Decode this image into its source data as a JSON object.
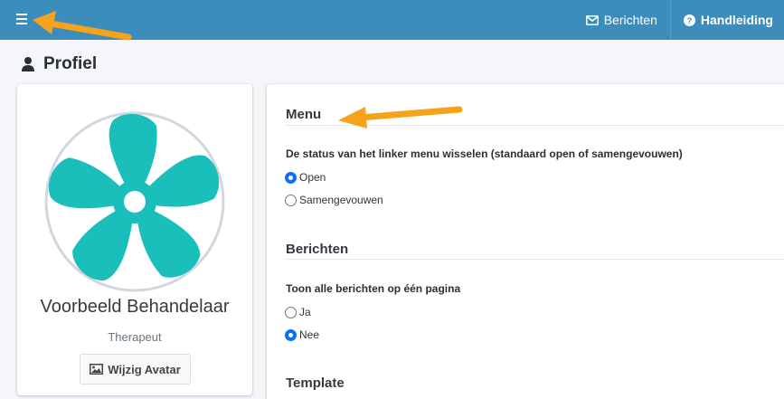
{
  "header": {
    "nav": [
      {
        "label": "Berichten",
        "icon": "envelope-icon"
      },
      {
        "label": "Handleiding",
        "icon": "question-circle-icon"
      }
    ]
  },
  "page": {
    "title": "Profiel",
    "icon": "user-icon"
  },
  "profile": {
    "name": "Voorbeeld Behandelaar",
    "role": "Therapeut",
    "change_avatar_label": "Wijzig Avatar",
    "avatar_icon": "flower-icon"
  },
  "settings": {
    "menu": {
      "title": "Menu",
      "question": "De status van het linker menu wisselen (standaard open of samengevouwen)",
      "options": [
        {
          "label": "Open",
          "checked": true
        },
        {
          "label": "Samengevouwen",
          "checked": false
        }
      ]
    },
    "messages": {
      "title": "Berichten",
      "question": "Toon alle berichten op één pagina",
      "options": [
        {
          "label": "Ja",
          "checked": false
        },
        {
          "label": "Nee",
          "checked": true
        }
      ]
    },
    "template": {
      "title": "Template"
    }
  },
  "colors": {
    "header": "#3c8dbc",
    "background": "#f4f6f9",
    "avatar_flower": "#1abfbb",
    "annotation_arrow": "#f5a31a",
    "radio_checked": "#0d6efd"
  }
}
